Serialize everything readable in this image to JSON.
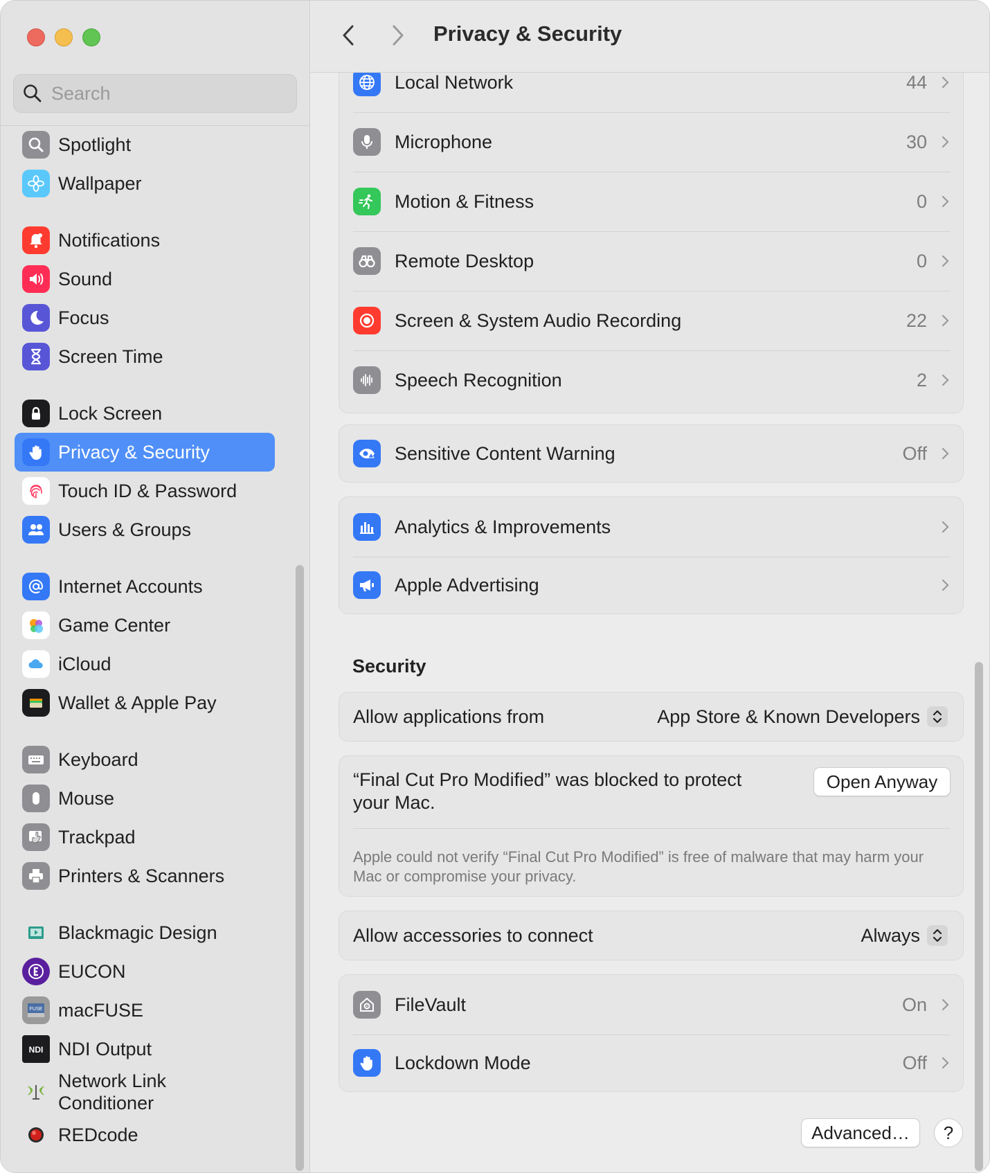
{
  "window": {
    "title": "Privacy & Security"
  },
  "search": {
    "placeholder": "Search"
  },
  "sidebar": {
    "items": [
      {
        "label": "Spotlight",
        "icon": "spotlight-icon"
      },
      {
        "label": "Wallpaper",
        "icon": "wallpaper-icon"
      },
      {
        "label": "Notifications",
        "icon": "notifications-icon"
      },
      {
        "label": "Sound",
        "icon": "sound-icon"
      },
      {
        "label": "Focus",
        "icon": "focus-icon"
      },
      {
        "label": "Screen Time",
        "icon": "screen-time-icon"
      },
      {
        "label": "Lock Screen",
        "icon": "lock-screen-icon"
      },
      {
        "label": "Privacy & Security",
        "icon": "privacy-hand-icon",
        "selected": true
      },
      {
        "label": "Touch ID & Password",
        "icon": "fingerprint-icon"
      },
      {
        "label": "Users & Groups",
        "icon": "users-icon"
      },
      {
        "label": "Internet Accounts",
        "icon": "at-sign-icon"
      },
      {
        "label": "Game Center",
        "icon": "game-center-icon"
      },
      {
        "label": "iCloud",
        "icon": "icloud-icon"
      },
      {
        "label": "Wallet & Apple Pay",
        "icon": "wallet-icon"
      },
      {
        "label": "Keyboard",
        "icon": "keyboard-icon"
      },
      {
        "label": "Mouse",
        "icon": "mouse-icon"
      },
      {
        "label": "Trackpad",
        "icon": "trackpad-icon"
      },
      {
        "label": "Printers & Scanners",
        "icon": "printer-icon"
      },
      {
        "label": "Blackmagic Design",
        "icon": "blackmagic-icon"
      },
      {
        "label": "EUCON",
        "icon": "eucon-icon"
      },
      {
        "label": "macFUSE",
        "icon": "macfuse-icon",
        "icon_text": "FUSE"
      },
      {
        "label": "NDI Output",
        "icon": "ndi-icon",
        "icon_text": "NDI"
      },
      {
        "label": "Network Link\nConditioner",
        "icon": "network-link-icon"
      },
      {
        "label": "REDcode",
        "icon": "redcode-icon"
      }
    ]
  },
  "privacy_rows": [
    {
      "label": "Local Network",
      "value": "44",
      "icon": "globe-icon"
    },
    {
      "label": "Microphone",
      "value": "30",
      "icon": "microphone-icon"
    },
    {
      "label": "Motion & Fitness",
      "value": "0",
      "icon": "running-figure-icon"
    },
    {
      "label": "Remote Desktop",
      "value": "0",
      "icon": "binoculars-icon"
    },
    {
      "label": "Screen & System Audio Recording",
      "value": "22",
      "icon": "record-icon"
    },
    {
      "label": "Speech Recognition",
      "value": "2",
      "icon": "waveform-icon"
    }
  ],
  "sensitive": {
    "label": "Sensitive Content Warning",
    "value": "Off",
    "icon": "eye-warning-icon"
  },
  "analytics_rows": [
    {
      "label": "Analytics & Improvements",
      "icon": "bar-chart-icon"
    },
    {
      "label": "Apple Advertising",
      "icon": "megaphone-icon"
    }
  ],
  "security": {
    "title": "Security",
    "allow_apps_label": "Allow applications from",
    "allow_apps_value": "App Store & Known Developers",
    "blocked_message": "“Final Cut Pro Modified” was blocked to protect your Mac.",
    "open_anyway": "Open Anyway",
    "blocked_detail": "Apple could not verify “Final Cut Pro Modified” is free of malware that may harm your Mac or compromise your privacy.",
    "accessories_label": "Allow accessories to connect",
    "accessories_value": "Always",
    "filevault": {
      "label": "FileVault",
      "value": "On",
      "icon": "filevault-house-icon"
    },
    "lockdown": {
      "label": "Lockdown Mode",
      "value": "Off",
      "icon": "lockdown-hand-icon"
    },
    "advanced_button": "Advanced…",
    "help_button": "?"
  },
  "colors": {
    "accent": "#4f8ff7",
    "sidebar_bg": "#e3e3e3",
    "content_bg": "#ececec"
  }
}
